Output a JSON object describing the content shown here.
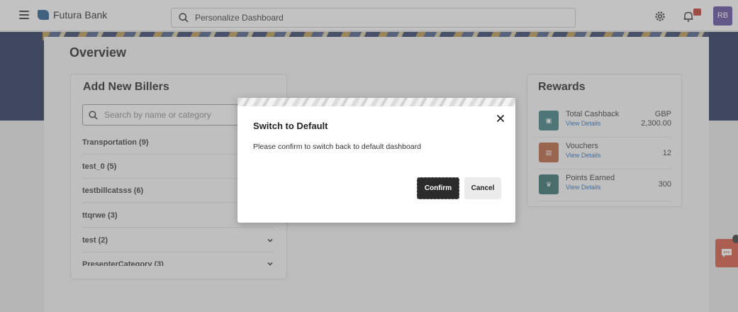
{
  "header": {
    "brand": "Futura Bank",
    "search_value": "Personalize Dashboard",
    "avatar_initials": "RB"
  },
  "page": {
    "title": "Overview"
  },
  "billers": {
    "title": "Add New Billers",
    "search_placeholder": "Search by name or category",
    "categories": [
      {
        "label": "Transportation (9)"
      },
      {
        "label": "test_0 (5)"
      },
      {
        "label": "testbillcatsss (6)"
      },
      {
        "label": "ttqrwe (3)"
      },
      {
        "label": "test (2)"
      },
      {
        "label": "PresenterCategory (3)"
      }
    ]
  },
  "rewards": {
    "title": "Rewards",
    "items": [
      {
        "name": "Total Cashback",
        "link": "View Details",
        "currency": "GBP",
        "value": "2,300.00",
        "color": "#3a7c7c"
      },
      {
        "name": "Vouchers",
        "link": "View Details",
        "currency": "",
        "value": "12",
        "color": "#b8603a"
      },
      {
        "name": "Points Earned",
        "link": "View Details",
        "currency": "",
        "value": "300",
        "color": "#2f6d6a"
      }
    ]
  },
  "modal": {
    "title": "Switch to Default",
    "message": "Please confirm to switch back to default dashboard",
    "confirm_label": "Confirm",
    "cancel_label": "Cancel"
  },
  "colors": {
    "banner": "#1f2e55",
    "accent_link": "#2a6ebf",
    "chat_fab": "#d9553c",
    "confirm_bg": "#2b2b2b"
  }
}
